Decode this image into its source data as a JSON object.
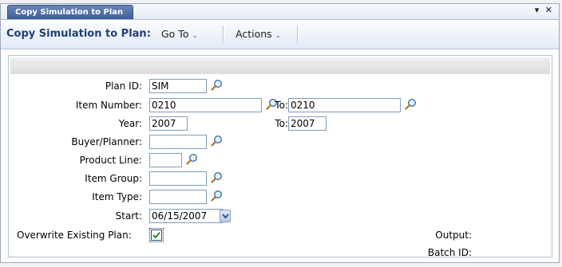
{
  "tab": {
    "title": "Copy Simulation to Plan",
    "controls": "▾ ✕"
  },
  "toolbar": {
    "title": "Copy Simulation to Plan:",
    "goto_label": "Go To",
    "actions_label": "Actions"
  },
  "form": {
    "plan_id": {
      "label": "Plan ID:",
      "value": "SIM"
    },
    "item_number": {
      "label": "Item Number:",
      "value": "0210",
      "to_label": "To:",
      "to_value": "0210"
    },
    "year": {
      "label": "Year:",
      "value": "2007",
      "to_label": "To:",
      "to_value": "2007"
    },
    "buyer_planner": {
      "label": "Buyer/Planner:",
      "value": ""
    },
    "product_line": {
      "label": "Product Line:",
      "value": ""
    },
    "item_group": {
      "label": "Item Group:",
      "value": ""
    },
    "item_type": {
      "label": "Item Type:",
      "value": ""
    },
    "start": {
      "label": "Start:",
      "value": "06/15/2007"
    },
    "overwrite": {
      "label": "Overwrite Existing Plan:",
      "checked": true
    },
    "output": {
      "label": "Output:"
    },
    "batch_id": {
      "label": "Batch ID:"
    }
  },
  "colors": {
    "tab_bg": "#3d5d99",
    "toolbar_title": "#1f3f77",
    "field_border": "#7f9db9",
    "checkmark": "#2a8a2a"
  }
}
